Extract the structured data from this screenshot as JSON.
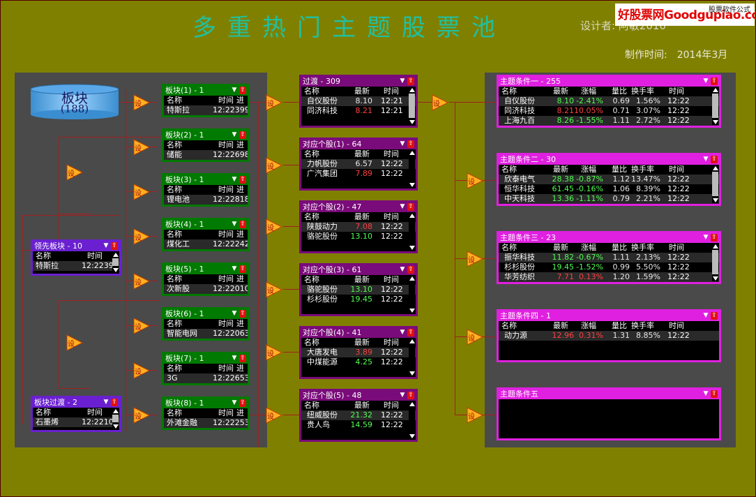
{
  "title": "多重热门主题股票池",
  "designer": "设计者:  阿敏2010",
  "made_label": "制作时间:",
  "made_date": "2014年3月",
  "watermark": {
    "brand": "好股票网Goodgupiao.com",
    "tag": "股票软件公式"
  },
  "colors": {
    "bg": "#808000",
    "green_border": "#007a00",
    "purple_border": "#7a0b7a",
    "violet_border": "#6a20d0",
    "magenta_border": "#e020e0",
    "up": "#ff4040",
    "down": "#50ff50"
  },
  "sector_db": {
    "label": "板块",
    "count": "(188)"
  },
  "arrow_label": "设",
  "sector_windows": [
    {
      "title": "板块(1) - 1",
      "cols": [
        "名称",
        "时间",
        "进"
      ],
      "name": "特斯拉",
      "time": "12:22399"
    },
    {
      "title": "板块(2) - 1",
      "cols": [
        "名称",
        "时间",
        "进"
      ],
      "name": "储能",
      "time": "12:22698"
    },
    {
      "title": "板块(3) - 1",
      "cols": [
        "名称",
        "时间",
        "进"
      ],
      "name": "锂电池",
      "time": "12:22818"
    },
    {
      "title": "板块(4) - 1",
      "cols": [
        "名称",
        "时间",
        "进"
      ],
      "name": "煤化工",
      "time": "12:22242"
    },
    {
      "title": "板块(5) - 1",
      "cols": [
        "名称",
        "时间",
        "进"
      ],
      "name": "次新股",
      "time": "12:22010"
    },
    {
      "title": "板块(6) - 1",
      "cols": [
        "名称",
        "时间",
        "进"
      ],
      "name": "智能电网",
      "time": "12:22063"
    },
    {
      "title": "板块(7) - 1",
      "cols": [
        "名称",
        "时间",
        "进"
      ],
      "name": "3G",
      "time": "12:22653"
    },
    {
      "title": "板块(8) - 1",
      "cols": [
        "名称",
        "时间",
        "进"
      ],
      "name": "外滩金融",
      "time": "12:22253"
    }
  ],
  "leading_sector": {
    "title": "领先板块 - 10",
    "cols": [
      "名称",
      "时间"
    ],
    "name": "特斯拉",
    "time": "12:2239"
  },
  "sector_transition": {
    "title": "板块过渡 - 2",
    "cols": [
      "名称",
      "时间"
    ],
    "name": "石墨烯",
    "time": "12:2210"
  },
  "stock_windows": [
    {
      "title": "过渡 - 309",
      "cols": [
        "名称",
        "最新",
        "时间"
      ],
      "rows": [
        {
          "name": "自仪股份",
          "price": "8.10",
          "dir": "w",
          "time": "12:21"
        },
        {
          "name": "同济科技",
          "price": "8.21",
          "dir": "r",
          "time": "12:21"
        }
      ]
    },
    {
      "title": "对应个股(1) - 64",
      "cols": [
        "名称",
        "最新",
        "时间"
      ],
      "rows": [
        {
          "name": "力帆股份",
          "price": "6.57",
          "dir": "w",
          "time": "12:22"
        },
        {
          "name": "广汽集团",
          "price": "7.89",
          "dir": "r",
          "time": "12:22"
        }
      ]
    },
    {
      "title": "对应个股(2) - 47",
      "cols": [
        "名称",
        "最新",
        "时间"
      ],
      "rows": [
        {
          "name": "陕鼓动力",
          "price": "7.08",
          "dir": "r",
          "time": "12:22"
        },
        {
          "name": "骆驼股份",
          "price": "13.10",
          "dir": "gr",
          "time": "12:22"
        }
      ]
    },
    {
      "title": "对应个股(3) - 61",
      "cols": [
        "名称",
        "最新",
        "时间"
      ],
      "rows": [
        {
          "name": "骆驼股份",
          "price": "13.10",
          "dir": "gr",
          "time": "12:22"
        },
        {
          "name": "杉杉股份",
          "price": "19.45",
          "dir": "gr",
          "time": "12:22"
        }
      ]
    },
    {
      "title": "对应个股(4) - 41",
      "cols": [
        "名称",
        "最新",
        "时间"
      ],
      "rows": [
        {
          "name": "大唐发电",
          "price": "3.89",
          "dir": "r",
          "time": "12:22"
        },
        {
          "name": "中煤能源",
          "price": "4.25",
          "dir": "gr",
          "time": "12:22"
        }
      ]
    },
    {
      "title": "对应个股(5) - 48",
      "cols": [
        "名称",
        "最新",
        "时间"
      ],
      "rows": [
        {
          "name": "纽威股份",
          "price": "21.32",
          "dir": "gr",
          "time": "12:22"
        },
        {
          "name": "贵人鸟",
          "price": "14.59",
          "dir": "gr",
          "time": "12:22"
        }
      ]
    }
  ],
  "theme_windows": [
    {
      "title": "主题条件一 - 255",
      "cols": [
        "名称",
        "最新",
        "涨幅",
        "量比",
        "换手率",
        "时间"
      ],
      "rows": [
        {
          "name": "自仪股份",
          "price": "8.10",
          "chg": "-2.41%",
          "cls": "gr",
          "vr": "0.69",
          "turn": "1.56%",
          "time": "12:22"
        },
        {
          "name": "同济科技",
          "price": "8.21",
          "chg": "10.05%",
          "cls": "r",
          "vr": "0.71",
          "turn": "3.07%",
          "time": "12:22"
        },
        {
          "name": "上海九百",
          "price": "8.26",
          "chg": "-1.55%",
          "cls": "gr",
          "vr": "1.11",
          "turn": "2.72%",
          "time": "12:22"
        }
      ]
    },
    {
      "title": "主题条件二 - 30",
      "cols": [
        "名称",
        "最新",
        "涨幅",
        "量比",
        "换手率",
        "时间"
      ],
      "rows": [
        {
          "name": "欣泰电气",
          "price": "28.38",
          "chg": "-0.87%",
          "cls": "gr",
          "vr": "1.12",
          "turn": "13.47%",
          "time": "12:22"
        },
        {
          "name": "恒华科技",
          "price": "61.45",
          "chg": "-0.16%",
          "cls": "gr",
          "vr": "1.06",
          "turn": "8.39%",
          "time": "12:22"
        },
        {
          "name": "中天科技",
          "price": "13.36",
          "chg": "-1.11%",
          "cls": "gr",
          "vr": "0.79",
          "turn": "2.21%",
          "time": "12:22"
        }
      ]
    },
    {
      "title": "主题条件三 - 23",
      "cols": [
        "名称",
        "最新",
        "涨幅",
        "量比",
        "换手率",
        "时间"
      ],
      "rows": [
        {
          "name": "振华科技",
          "price": "11.82",
          "chg": "-0.67%",
          "cls": "gr",
          "vr": "1.11",
          "turn": "2.13%",
          "time": "12:22"
        },
        {
          "name": "杉杉股份",
          "price": "19.45",
          "chg": "-1.52%",
          "cls": "gr",
          "vr": "0.99",
          "turn": "5.50%",
          "time": "12:22"
        },
        {
          "name": "华芳纺织",
          "price": "7.71",
          "chg": "0.13%",
          "cls": "r",
          "vr": "1.20",
          "turn": "1.59%",
          "time": "12:22"
        }
      ]
    },
    {
      "title": "主题条件四 - 1",
      "cols": [
        "名称",
        "最新",
        "涨幅",
        "量比",
        "换手率",
        "时间"
      ],
      "rows": [
        {
          "name": "动力源",
          "price": "12.96",
          "chg": "0.31%",
          "cls": "r",
          "vr": "1.31",
          "turn": "8.85%",
          "time": "12:22"
        }
      ]
    },
    {
      "title": "主题条件五",
      "cols": [],
      "rows": []
    }
  ]
}
